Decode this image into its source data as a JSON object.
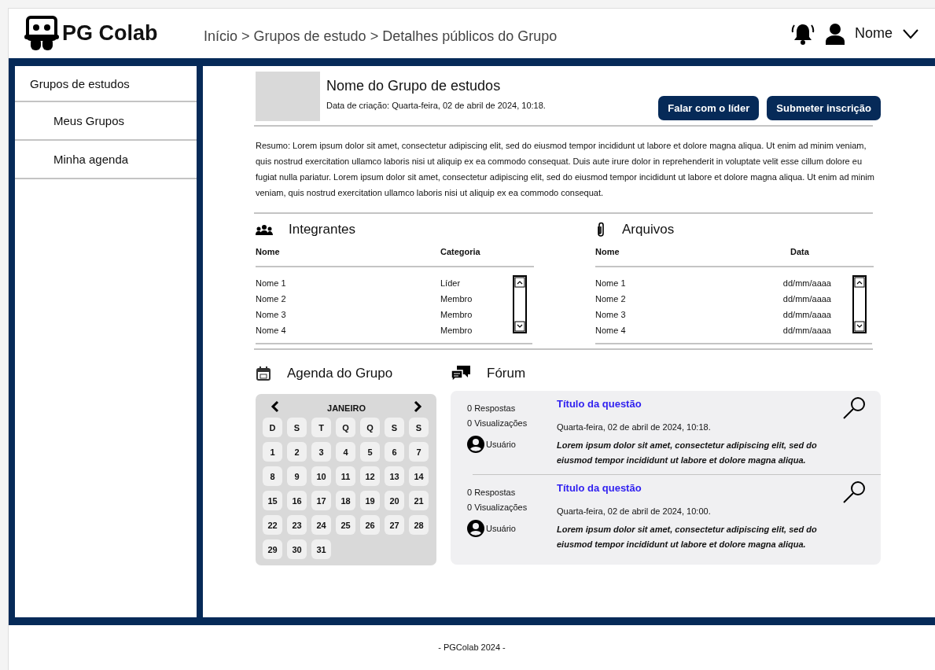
{
  "header": {
    "logo": "PG Colab",
    "breadcrumb": "Início > Grupos de estudo > Detalhes públicos do Grupo",
    "user_name": "Nome"
  },
  "sidebar": {
    "items": [
      {
        "label": "Grupos de estudos",
        "children": [
          {
            "label": "Meus Grupos"
          },
          {
            "label": "Minha agenda"
          }
        ]
      }
    ]
  },
  "group": {
    "name": "Nome do Grupo de estudos",
    "created": "Data de criação: Quarta-feira, 02 de abril de 2024, 10:18.",
    "buttons": [
      "Falar com o líder",
      "Submeter inscrição"
    ],
    "summary": "Resumo: Lorem ipsum dolor sit amet, consectetur adipiscing elit, sed do eiusmod tempor incididunt ut labore et dolore magna aliqua. Ut enim ad minim veniam, quis nostrud exercitation ullamco laboris nisi ut aliquip ex ea commodo consequat. Duis aute irure dolor in reprehenderit in voluptate velit esse cillum dolore eu fugiat nulla pariatur. Lorem ipsum dolor sit amet, consectetur adipiscing elit, sed do eiusmod tempor incididunt ut labore et dolore magna aliqua. Ut enim ad minim veniam, quis nostrud exercitation ullamco laboris nisi ut aliquip ex ea commodo consequat."
  },
  "members": {
    "title": "Integrantes",
    "columns": [
      "Nome",
      "Categoria"
    ],
    "rows": [
      [
        "Nome 1",
        "Líder"
      ],
      [
        "Nome 2",
        "Membro"
      ],
      [
        "Nome 3",
        "Membro"
      ],
      [
        "Nome 4",
        "Membro"
      ]
    ]
  },
  "files": {
    "title": "Arquivos",
    "columns": [
      "Nome",
      "Data"
    ],
    "rows": [
      [
        "Nome 1",
        "dd/mm/aaaa"
      ],
      [
        "Nome 2",
        "dd/mm/aaaa"
      ],
      [
        "Nome 3",
        "dd/mm/aaaa"
      ],
      [
        "Nome 4",
        "dd/mm/aaaa"
      ]
    ]
  },
  "agenda": {
    "title": "Agenda do Grupo",
    "month": "JANEIRO",
    "weekdays": [
      "D",
      "S",
      "T",
      "Q",
      "Q",
      "S",
      "S"
    ],
    "days": [
      "1",
      "2",
      "3",
      "4",
      "5",
      "6",
      "7",
      "8",
      "9",
      "10",
      "11",
      "12",
      "13",
      "14",
      "15",
      "16",
      "17",
      "18",
      "19",
      "20",
      "21",
      "22",
      "23",
      "24",
      "25",
      "26",
      "27",
      "28",
      "29",
      "30",
      "31"
    ]
  },
  "forum": {
    "title": "Fórum",
    "posts": [
      {
        "answers": "0 Respostas",
        "views": "0 Visualizações",
        "user": "Usuário",
        "title": "Título da questão",
        "date": "Quarta-feira, 02 de abril de 2024, 10:18.",
        "body": "Lorem ipsum dolor sit amet, consectetur adipiscing elit, sed do eiusmod tempor incididunt ut labore et dolore magna aliqua."
      },
      {
        "answers": "0 Respostas",
        "views": "0 Visualizações",
        "user": "Usuário",
        "title": "Título da questão",
        "date": "Quarta-feira, 02 de abril de 2024, 10:00.",
        "body": "Lorem ipsum dolor sit amet, consectetur adipiscing elit, sed do eiusmod tempor incididunt ut labore et dolore magna aliqua."
      }
    ]
  },
  "footer": "- PGColab 2024 -"
}
